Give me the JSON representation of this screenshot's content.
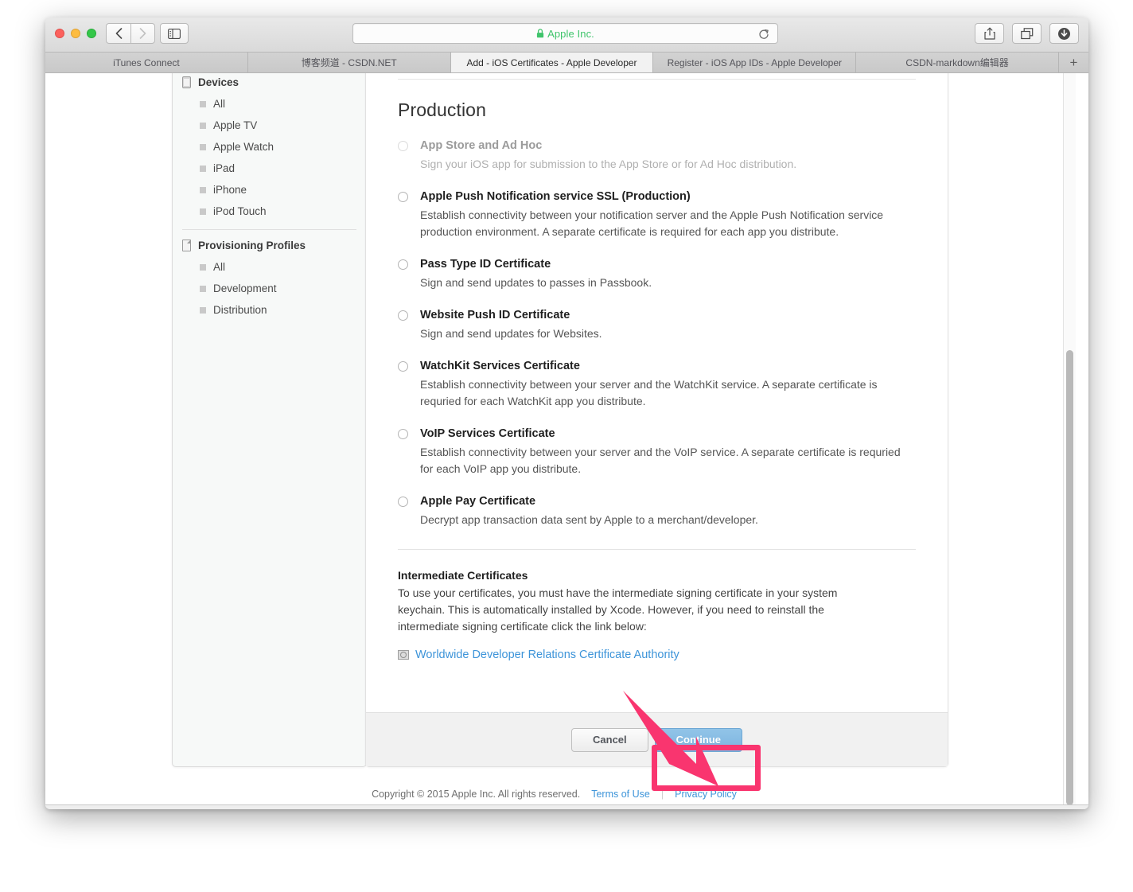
{
  "browser": {
    "traffic_lights": [
      "close",
      "minimize",
      "zoom"
    ],
    "nav": {
      "back": "‹",
      "forward": "›"
    },
    "address": {
      "site_label": "Apple Inc.",
      "lock_icon": "lock-icon"
    },
    "toolbar_right": [
      "share-icon",
      "tab-overview-icon",
      "downloads-icon"
    ],
    "tabs": [
      {
        "label": "iTunes Connect",
        "active": false
      },
      {
        "label": "博客频道 - CSDN.NET",
        "active": false
      },
      {
        "label": "Add - iOS Certificates - Apple Developer",
        "active": true
      },
      {
        "label": "Register - iOS App IDs - Apple Developer",
        "active": false
      },
      {
        "label": "CSDN-markdown编辑器",
        "active": false
      }
    ],
    "new_tab_label": "+"
  },
  "sidebar": {
    "groups": [
      {
        "title": "Devices",
        "icon": "device-icon",
        "items": [
          "All",
          "Apple TV",
          "Apple Watch",
          "iPad",
          "iPhone",
          "iPod Touch"
        ]
      },
      {
        "title": "Provisioning Profiles",
        "icon": "document-icon",
        "items": [
          "All",
          "Development",
          "Distribution"
        ]
      }
    ]
  },
  "main": {
    "section_title": "Production",
    "options": [
      {
        "title": "App Store and Ad Hoc",
        "desc": "Sign your iOS app for submission to the App Store or for Ad Hoc distribution.",
        "disabled": true,
        "selected": false
      },
      {
        "title": "Apple Push Notification service SSL (Production)",
        "desc": "Establish connectivity between your notification server and the Apple Push Notification service production environment. A separate certificate is required for each app you distribute.",
        "disabled": false,
        "selected": false
      },
      {
        "title": "Pass Type ID Certificate",
        "desc": "Sign and send updates to passes in Passbook.",
        "disabled": false,
        "selected": false
      },
      {
        "title": "Website Push ID Certificate",
        "desc": "Sign and send updates for Websites.",
        "disabled": false,
        "selected": false
      },
      {
        "title": "WatchKit Services Certificate",
        "desc": "Establish connectivity between your server and the WatchKit service. A separate certificate is requried for each WatchKit app you distribute.",
        "disabled": false,
        "selected": false
      },
      {
        "title": "VoIP Services Certificate",
        "desc": "Establish connectivity between your server and the VoIP service. A separate certificate is requried for each VoIP app you distribute.",
        "disabled": false,
        "selected": false
      },
      {
        "title": "Apple Pay Certificate",
        "desc": "Decrypt app transaction data sent by Apple to a merchant/developer.",
        "disabled": false,
        "selected": false
      }
    ],
    "intermediate": {
      "title": "Intermediate Certificates",
      "desc": "To use your certificates, you must have the intermediate signing certificate in your system keychain. This is automatically installed by Xcode. However, if you need to reinstall the intermediate signing certificate click the link below:",
      "link_label": "Worldwide Developer Relations Certificate Authority",
      "link_icon": "certificate-file-icon"
    }
  },
  "buttons": {
    "cancel_label": "Cancel",
    "continue_label": "Continue"
  },
  "footer": {
    "copyright": "Copyright © 2015 Apple Inc. All rights reserved.",
    "terms_label": "Terms of Use",
    "separator": "|",
    "privacy_label": "Privacy Policy"
  },
  "annotation": {
    "arrow_color": "#f9356f",
    "highlight_color": "#f9356f",
    "target": "continue-button"
  }
}
